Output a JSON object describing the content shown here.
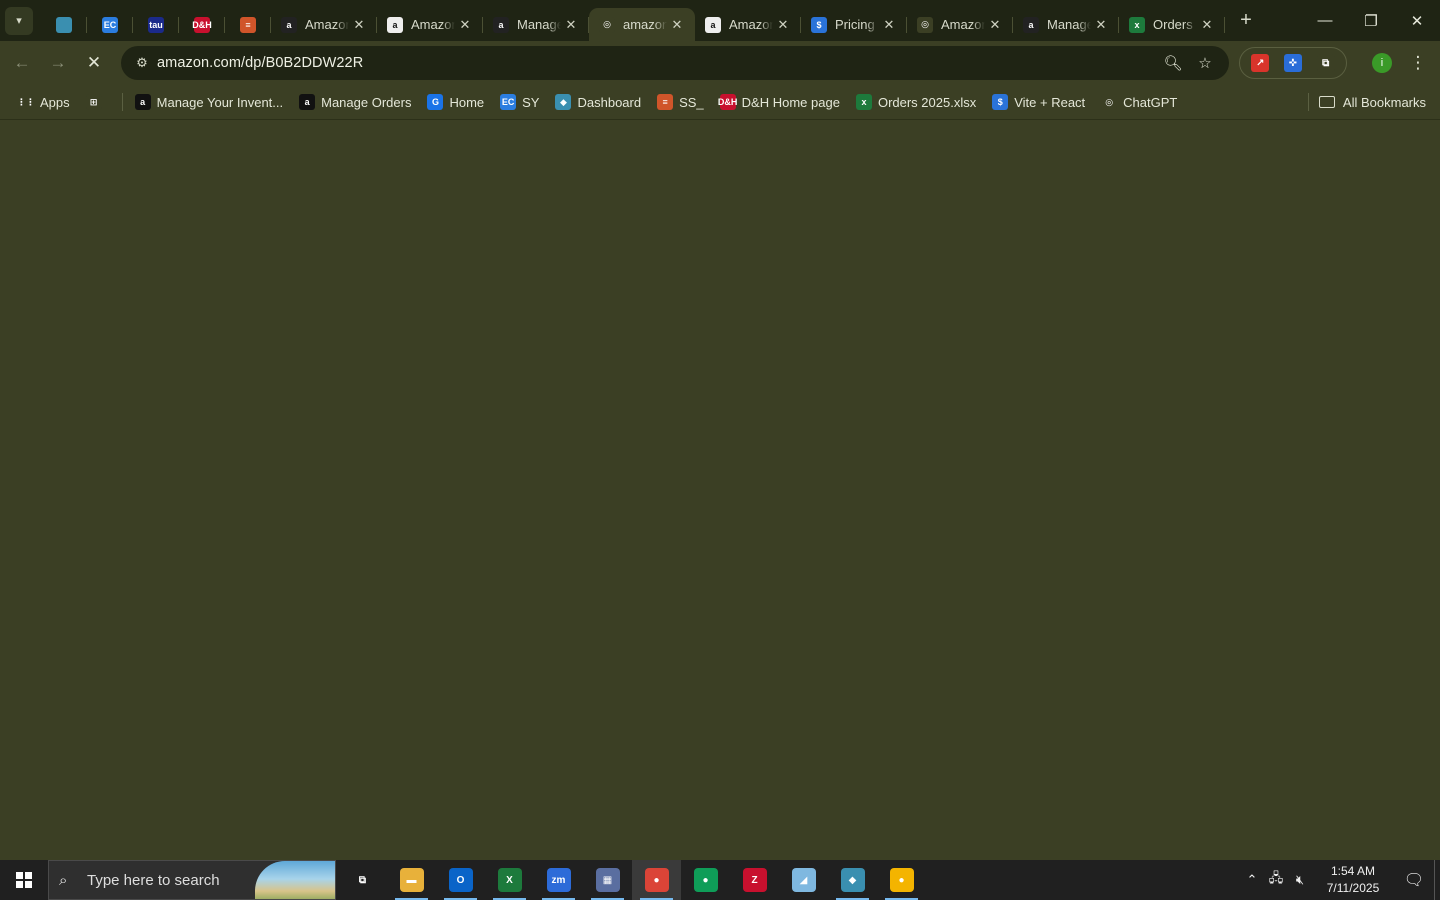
{
  "browser": {
    "tabs": [
      {
        "title": "",
        "favicon": "diamond-icon",
        "color": "#3a8fb0",
        "pinned": true
      },
      {
        "title": "",
        "favicon": "ec-icon",
        "glyph": "EC",
        "color": "#2b7de0",
        "pinned": true
      },
      {
        "title": "",
        "favicon": "tau-icon",
        "glyph": "tau",
        "color": "#1b2a8a",
        "pinned": true
      },
      {
        "title": "",
        "favicon": "dh-icon",
        "glyph": "D&H",
        "color": "#c8102e",
        "pinned": true
      },
      {
        "title": "",
        "favicon": "layers-icon",
        "glyph": "≡",
        "color": "#d0552a",
        "pinned": true
      },
      {
        "title": "Amazon",
        "favicon": "amazon-icon",
        "glyph": "a",
        "color": "#222222"
      },
      {
        "title": "Amazon",
        "favicon": "amazon-icon",
        "glyph": "a",
        "color": "#eeeeee"
      },
      {
        "title": "Manage",
        "favicon": "amazon-icon",
        "glyph": "a",
        "color": "#222222"
      },
      {
        "title": "amazon",
        "favicon": "loading-icon",
        "glyph": "◎",
        "color": "#3b3f24",
        "active": true
      },
      {
        "title": "Amazon",
        "favicon": "amazon-icon",
        "glyph": "a",
        "color": "#eeeeee"
      },
      {
        "title": "Pricing",
        "favicon": "dollar-icon",
        "glyph": "$",
        "color": "#2a73d8"
      },
      {
        "title": "Amazon",
        "favicon": "spiral-icon",
        "glyph": "◎",
        "color": "#3b3f24"
      },
      {
        "title": "Manage",
        "favicon": "amazon-icon",
        "glyph": "a",
        "color": "#222222"
      },
      {
        "title": "Orders",
        "favicon": "excel-icon",
        "glyph": "x",
        "color": "#1d7a3c"
      }
    ],
    "new_tab_label": "+",
    "address": {
      "url": "amazon.com/dp/B0B2DDW22R"
    },
    "extensions": [
      {
        "name": "arrow-extension-icon",
        "glyph": "↗",
        "color": "#d9342b"
      },
      {
        "name": "puzzle-blue-extension-icon",
        "glyph": "✜",
        "color": "#2a6dd8"
      },
      {
        "name": "extensions-icon",
        "glyph": "⧉",
        "color": "#3b3f24"
      }
    ],
    "profile_initial": "i",
    "bookmarks": [
      {
        "label": "Apps",
        "icon": "apps-grid-icon",
        "glyph": "⋮⋮",
        "color": "#3b3f24"
      },
      {
        "label": "",
        "icon": "tab-groups-icon",
        "glyph": "⊞",
        "color": "#3b3f24"
      },
      {
        "label": "Manage Your Invent...",
        "icon": "amazon-icon",
        "glyph": "a",
        "color": "#111111"
      },
      {
        "label": "Manage Orders",
        "icon": "amazon-icon",
        "glyph": "a",
        "color": "#111111"
      },
      {
        "label": "Home",
        "icon": "home-g-icon",
        "glyph": "G",
        "color": "#1a73e8"
      },
      {
        "label": "SY",
        "icon": "ec-icon",
        "glyph": "EC",
        "color": "#2b7de0"
      },
      {
        "label": "Dashboard",
        "icon": "diamond-icon",
        "glyph": "◆",
        "color": "#3a8fb0"
      },
      {
        "label": "SS_",
        "icon": "layers-icon",
        "glyph": "≡",
        "color": "#d0552a"
      },
      {
        "label": "D&H Home page",
        "icon": "dh-icon",
        "glyph": "D&H",
        "color": "#c8102e"
      },
      {
        "label": "Orders 2025.xlsx",
        "icon": "excel-icon",
        "glyph": "x",
        "color": "#1d7a3c"
      },
      {
        "label": "Vite + React",
        "icon": "dollar-icon",
        "glyph": "$",
        "color": "#2a73d8"
      },
      {
        "label": "ChatGPT",
        "icon": "chatgpt-icon",
        "glyph": "◎",
        "color": "#3b3f24"
      }
    ],
    "all_bookmarks_label": "All Bookmarks"
  },
  "taskbar": {
    "search_placeholder": "Type here to search",
    "apps": [
      {
        "name": "task-view-icon",
        "glyph": "⧉",
        "color": "#202020",
        "running": false
      },
      {
        "name": "file-explorer-icon",
        "glyph": "▬",
        "color": "#e8b13a",
        "running": true
      },
      {
        "name": "outlook-icon",
        "glyph": "O",
        "color": "#0a64c8",
        "running": true
      },
      {
        "name": "excel-icon",
        "glyph": "X",
        "color": "#1d7a3c",
        "running": true
      },
      {
        "name": "zoom-icon",
        "glyph": "zm",
        "color": "#2d6bd8",
        "running": true
      },
      {
        "name": "calculator-icon",
        "glyph": "▦",
        "color": "#5a6ea0",
        "running": true
      },
      {
        "name": "chrome-icon",
        "glyph": "●",
        "color": "#db4437",
        "running": true,
        "active": true
      },
      {
        "name": "chrome-profile-icon",
        "glyph": "●",
        "color": "#0f9d58",
        "running": false
      },
      {
        "name": "filezilla-icon",
        "glyph": "Z",
        "color": "#c8102e",
        "running": false
      },
      {
        "name": "notepad-icon",
        "glyph": "◢",
        "color": "#7fb8e0",
        "running": false
      },
      {
        "name": "diamond-app-icon",
        "glyph": "◆",
        "color": "#3a8fb0",
        "running": true
      },
      {
        "name": "chrome-user-icon",
        "glyph": "●",
        "color": "#f4b400",
        "running": true
      }
    ],
    "time": "1:54 AM",
    "date": "7/11/2025"
  }
}
